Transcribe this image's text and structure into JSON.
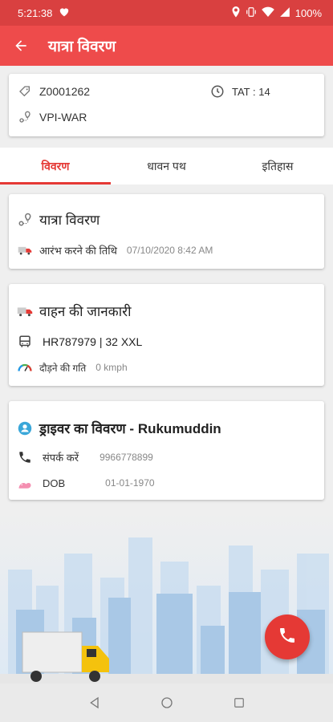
{
  "status": {
    "time": "5:21:38",
    "battery": "100%"
  },
  "appbar": {
    "title": "यात्रा विवरण"
  },
  "summary": {
    "trip_id": "Z0001262",
    "tat": "TAT : 14",
    "route": "VPI-WAR"
  },
  "tabs": [
    {
      "label": "विवरण",
      "active": true
    },
    {
      "label": "धावन पथ",
      "active": false
    },
    {
      "label": "इतिहास",
      "active": false
    }
  ],
  "trip_card": {
    "title": "यात्रा विवरण",
    "start_label": "आरंभ करने की तिथि",
    "start_value": "07/10/2020 8:42 AM"
  },
  "vehicle_card": {
    "title": "वाहन की जानकारी",
    "vehicle": "HR787979 | 32 XXL",
    "speed_label": "दौड़ने की गति",
    "speed_value": "0 kmph"
  },
  "driver_card": {
    "title": "ड्राइवर का विवरण - Rukumuddin",
    "contact_label": "संपर्क करें",
    "contact_value": "9966778899",
    "dob_label": "DOB",
    "dob_value": "01-01-1970"
  },
  "colors": {
    "primary": "#ee4b4b",
    "accent": "#e53935",
    "status_bar": "#d94040"
  }
}
